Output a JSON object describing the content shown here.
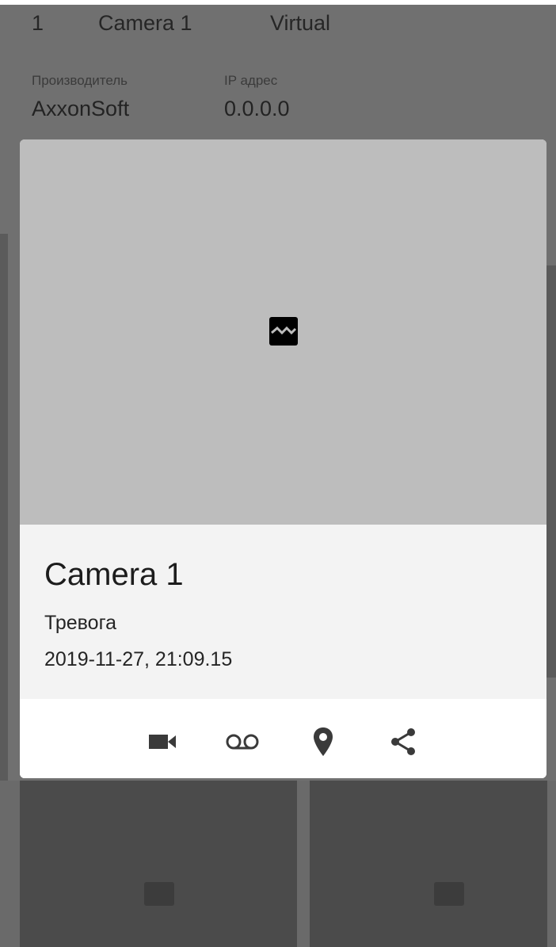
{
  "background": {
    "row": {
      "index": "1",
      "name": "Camera 1",
      "type": "Virtual"
    },
    "meta": [
      {
        "label": "Производитель",
        "value": "AxxonSoft"
      },
      {
        "label": "IP адрес",
        "value": "0.0.0.0"
      }
    ]
  },
  "dialog": {
    "title": "Camera 1",
    "event": "Тревога",
    "timestamp": "2019-11-27, 21:09.15",
    "actions": [
      {
        "icon": "videocam-icon"
      },
      {
        "icon": "voicemail-icon"
      },
      {
        "icon": "location-pin-icon"
      },
      {
        "icon": "share-icon"
      }
    ]
  },
  "colors": {
    "overlay": "#707070",
    "preview": "#bdbdbd",
    "info_bg": "#f3f3f3",
    "icon": "#3a3a3a"
  }
}
